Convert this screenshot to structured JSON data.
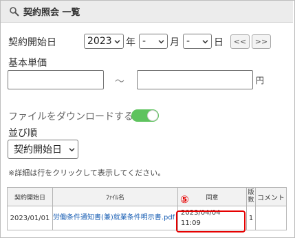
{
  "header": {
    "title": "契約照会 一覧",
    "icon": "search-icon"
  },
  "filters": {
    "start_date_label": "契約開始日",
    "year": "2023",
    "year_unit": "年",
    "month": "-",
    "month_unit": "月",
    "day": "-",
    "day_unit": "日",
    "prev_button": "<<",
    "next_button": ">>",
    "base_price_label": "基本単価",
    "range_sep": "～",
    "currency": "円",
    "download_label": "ファイルをダウンロードする",
    "download_enabled": true,
    "sort_label": "並び順",
    "sort_value": "契約開始日",
    "hint": "※詳細は行をクリックして表示してください。"
  },
  "table": {
    "columns": [
      "契約開始日",
      "ﾌｧｲﾙ名",
      "同意",
      "版数",
      "コメント"
    ],
    "rows": [
      {
        "start_date": "2023/01/01",
        "file_name": "労働条件通知書(兼)就業条件明示書.pdf",
        "agree_date": "2023/04/04",
        "agree_time": "11:09",
        "version": "1",
        "comment": ""
      }
    ]
  },
  "annotation": {
    "marker": "⑤",
    "color": "#e60000"
  },
  "colors": {
    "toggle_on": "#5ec35e",
    "link": "#1a5fb4",
    "header_bg": "#ececec"
  }
}
